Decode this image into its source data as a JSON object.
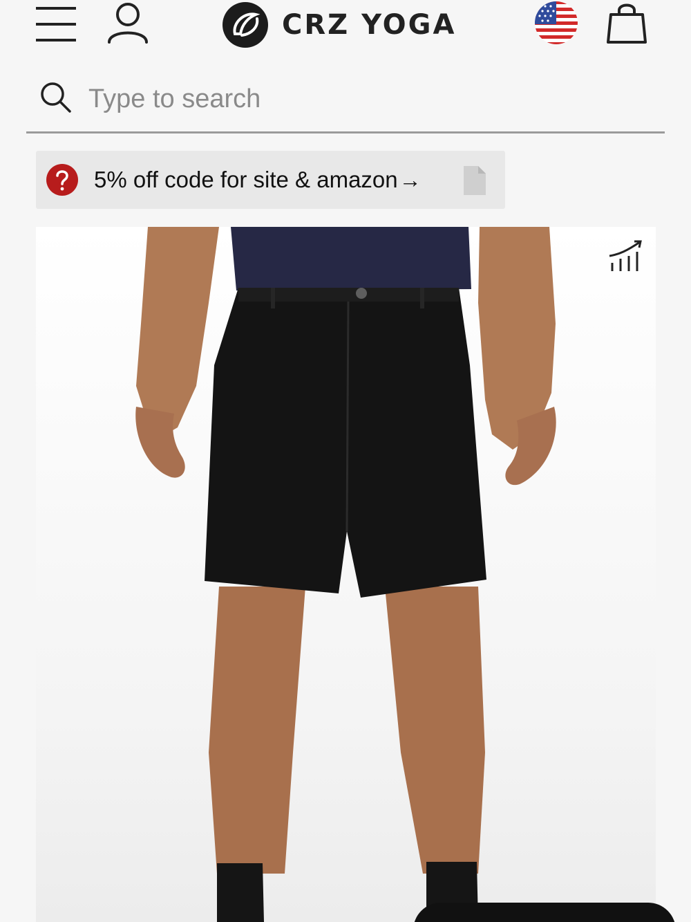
{
  "header": {
    "brand_name": "CRZ YOGA",
    "icons": {
      "menu": "menu-icon",
      "account": "user-icon",
      "region": "us-flag-icon",
      "cart": "shopping-bag-icon"
    }
  },
  "search": {
    "placeholder": "Type to search",
    "value": ""
  },
  "promo": {
    "text": "5% off code for site & amazon",
    "arrow": "→",
    "icons": {
      "help": "question-icon",
      "copy": "copy-document-icon"
    },
    "colors": {
      "help_badge": "#b71c1c",
      "background": "#e8e8e8"
    }
  },
  "product": {
    "image_alt": "Black men's shorts",
    "icons": {
      "size_chart": "size-chart-icon"
    },
    "colors": {
      "shorts": "#141414",
      "shirt": "#262845",
      "skin": "#b07a55"
    }
  }
}
